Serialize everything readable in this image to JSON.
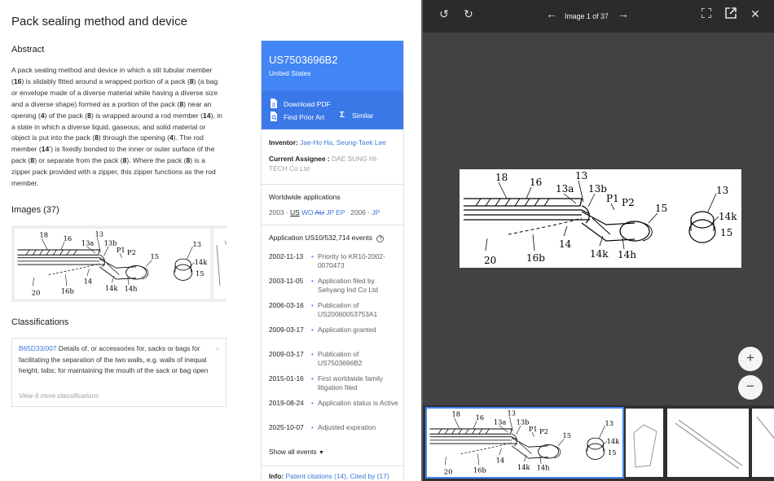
{
  "title": "Pack sealing method and device",
  "abstract": {
    "heading": "Abstract",
    "parts": [
      {
        "t": "A pack sealing method and device in which a slit tubular member (",
        "b": false
      },
      {
        "t": "16",
        "b": true
      },
      {
        "t": ") is slidably fitted around a wrapped portion of a pack (",
        "b": false
      },
      {
        "t": "8",
        "b": true
      },
      {
        "t": ") (a bag or envelope made of a diverse material while having a diverse size and a diverse shape) formed as a portion of the pack (",
        "b": false
      },
      {
        "t": "8",
        "b": true
      },
      {
        "t": ") near an opening (",
        "b": false
      },
      {
        "t": "4",
        "b": true
      },
      {
        "t": ") of the pack (",
        "b": false
      },
      {
        "t": "8",
        "b": true
      },
      {
        "t": ") is wrapped around a rod member (",
        "b": false
      },
      {
        "t": "14",
        "b": true
      },
      {
        "t": "), in a state in which a diverse liquid, gaseous, and solid material or object is put into the pack (",
        "b": false
      },
      {
        "t": "8",
        "b": true
      },
      {
        "t": ") through the opening (",
        "b": false
      },
      {
        "t": "4",
        "b": true
      },
      {
        "t": "). The rod member (",
        "b": false
      },
      {
        "t": "14",
        "b": true
      },
      {
        "t": "’) is fixedly bonded to the inner or outer surface of the pack (",
        "b": false
      },
      {
        "t": "8",
        "b": true
      },
      {
        "t": ") or separate from the pack (",
        "b": false
      },
      {
        "t": "8",
        "b": true
      },
      {
        "t": "). Where the pack (",
        "b": false
      },
      {
        "t": "8",
        "b": true
      },
      {
        "t": ") is a zipper pack provided with a zipper, this zipper functions as the rod member.",
        "b": false
      }
    ]
  },
  "images": {
    "heading": "Images (37)"
  },
  "classifications": {
    "heading": "Classifications",
    "code": "B65D33/007",
    "description": "Details of, or accessories for, sacks or bags for facilitating the separation of the two walls, e.g. walls of inequal height, tabs; for maintaining the mouth of the sack or bag open",
    "more": "View 6 more classifications"
  },
  "patent": {
    "number": "US7503696B2",
    "country": "United States",
    "download_pdf": "Download PDF",
    "find_prior_art": "Find Prior Art",
    "similar": "Similar",
    "inventor_label": "Inventor:",
    "inventors": "Jae-Ho Ha, Seung-Taek Lee",
    "assignee_label": "Current Assignee :",
    "assignee": "DAE SUNG HI-TECH Co Ltd",
    "worldwide_heading": "Worldwide applications",
    "ww_year1": "2003",
    "ww_us": "US",
    "ww_wo": "WO",
    "ww_au": "AU",
    "ww_jp": "JP",
    "ww_ep": "EP",
    "ww_year2": "2006",
    "ww_jp2": "JP",
    "events_heading": "Application US10/532,714 events",
    "events": [
      {
        "date": "2002-11-13",
        "text": "Priority to KR10-2002-0070473"
      },
      {
        "date": "2003-11-05",
        "text": "Application filed by Sehyang Ind Co Ltd"
      },
      {
        "date": "2006-03-16",
        "text": "Publication of US20060053753A1"
      },
      {
        "date": "2009-03-17",
        "text": "Application granted"
      },
      {
        "date": "2009-03-17",
        "text": "Publication of US7503696B2"
      },
      {
        "date": "2015-01-16",
        "text": "First worldwide family litigation filed"
      },
      {
        "date": "2019-08-24",
        "text": "Application status is Active"
      },
      {
        "date": "2025-10-07",
        "text": "Adjusted expiration"
      }
    ],
    "show_all": "Show all events",
    "info_label": "Info:",
    "info_links": "Patent citations (14), Cited by (17)"
  },
  "viewer": {
    "counter": "Image 1 of 37",
    "figure_labels": [
      "18",
      "16",
      "13",
      "13a",
      "13b",
      "P1",
      "P2",
      "15",
      "13",
      "14k",
      "15",
      "20",
      "16b",
      "14",
      "14k",
      "14h"
    ]
  }
}
